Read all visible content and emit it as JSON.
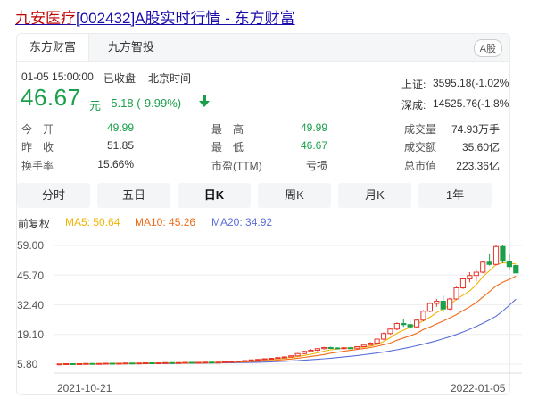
{
  "title": {
    "name_part": "九安医疗",
    "rest_part": "[002432]A股实时行情 - 东方财富"
  },
  "tabs": [
    "东方财富",
    "九方智投"
  ],
  "market_badge": "A股",
  "quote": {
    "datetime": "01-05 15:00:00",
    "status": "已收盘",
    "timezone": "北京时间",
    "price": "46.67",
    "unit": "元",
    "change": "-5.18 (-9.99%)"
  },
  "indices": [
    {
      "name": "上证:",
      "value": "3595.18(-1.02%)"
    },
    {
      "name": "深成:",
      "value": "14525.76(-1.8%)"
    }
  ],
  "stats": {
    "open_label": "今　开",
    "open": "49.99",
    "prev_label": "昨　收",
    "prev": "51.85",
    "turnover_label": "换手率",
    "turnover": "15.66%",
    "high_label": "最　高",
    "high": "49.99",
    "low_label": "最　低",
    "low": "46.67",
    "pe_label": "市盈(TTM)",
    "pe": "亏损",
    "vol_label": "成交量",
    "vol": "74.93万手",
    "amt_label": "成交额",
    "amt": "35.60亿",
    "cap_label": "总市值",
    "cap": "223.36亿"
  },
  "period_buttons": [
    "分时",
    "五日",
    "日K",
    "周K",
    "月K",
    "1年"
  ],
  "active_period": "日K",
  "indicators": {
    "adjust": "前复权",
    "ma5": "MA5: 50.64",
    "ma10": "MA10: 45.26",
    "ma20": "MA20: 34.92"
  },
  "colors": {
    "up": "#e8342d",
    "down": "#1aa04b",
    "ma5": "#f0b400",
    "ma10": "#f06a1a",
    "ma20": "#5b6ed8"
  },
  "chart_data": {
    "type": "candlestick",
    "y_ticks": [
      "59.00",
      "45.70",
      "32.40",
      "19.10",
      "5.80"
    ],
    "ylim": [
      5.8,
      59.0
    ],
    "x_labels": [
      "2021-10-21",
      "2022-01-05"
    ],
    "candles": [
      [
        5.8,
        5.9,
        5.7,
        5.9
      ],
      [
        5.9,
        6.0,
        5.8,
        6.0
      ],
      [
        6.0,
        6.0,
        5.9,
        5.9
      ],
      [
        5.9,
        6.0,
        5.8,
        6.0
      ],
      [
        6.0,
        6.1,
        5.9,
        6.1
      ],
      [
        6.1,
        6.1,
        6.0,
        6.0
      ],
      [
        6.0,
        6.1,
        5.9,
        6.1
      ],
      [
        6.1,
        6.2,
        6.0,
        6.2
      ],
      [
        6.2,
        6.2,
        6.1,
        6.1
      ],
      [
        6.1,
        6.2,
        6.0,
        6.2
      ],
      [
        6.2,
        6.3,
        6.1,
        6.3
      ],
      [
        6.3,
        6.3,
        6.2,
        6.2
      ],
      [
        6.2,
        6.3,
        6.1,
        6.3
      ],
      [
        6.3,
        6.4,
        6.2,
        6.4
      ],
      [
        6.4,
        6.4,
        6.3,
        6.3
      ],
      [
        6.3,
        6.4,
        6.2,
        6.4
      ],
      [
        6.4,
        6.5,
        6.3,
        6.5
      ],
      [
        6.5,
        6.5,
        6.4,
        6.4
      ],
      [
        6.4,
        6.5,
        6.3,
        6.5
      ],
      [
        6.5,
        6.6,
        6.4,
        6.6
      ],
      [
        6.6,
        6.6,
        6.5,
        6.5
      ],
      [
        6.5,
        6.6,
        6.4,
        6.6
      ],
      [
        6.6,
        6.7,
        6.5,
        6.7
      ],
      [
        6.7,
        6.7,
        6.6,
        6.6
      ],
      [
        6.6,
        6.7,
        6.5,
        6.7
      ],
      [
        6.7,
        6.9,
        6.6,
        6.9
      ],
      [
        6.9,
        7.1,
        6.8,
        7.0
      ],
      [
        7.0,
        7.3,
        6.9,
        7.2
      ],
      [
        7.2,
        7.5,
        7.1,
        7.4
      ],
      [
        7.4,
        7.8,
        7.3,
        7.7
      ],
      [
        7.7,
        8.1,
        7.6,
        7.9
      ],
      [
        7.9,
        8.3,
        7.8,
        8.2
      ],
      [
        8.2,
        8.6,
        8.1,
        8.4
      ],
      [
        8.4,
        8.9,
        8.3,
        8.7
      ],
      [
        8.7,
        9.3,
        8.6,
        9.0
      ],
      [
        9.0,
        9.8,
        8.9,
        9.5
      ],
      [
        9.5,
        10.8,
        9.4,
        10.5
      ],
      [
        10.5,
        11.8,
        10.2,
        11.5
      ],
      [
        11.5,
        12.5,
        11.0,
        12.0
      ],
      [
        12.0,
        13.0,
        11.6,
        12.7
      ],
      [
        12.7,
        13.5,
        12.3,
        13.2
      ],
      [
        13.2,
        13.6,
        12.8,
        13.0
      ],
      [
        13.0,
        13.4,
        12.6,
        12.9
      ],
      [
        12.9,
        13.3,
        12.5,
        13.1
      ],
      [
        13.1,
        13.5,
        12.7,
        12.9
      ],
      [
        12.9,
        13.8,
        12.7,
        13.6
      ],
      [
        13.6,
        14.5,
        13.4,
        14.3
      ],
      [
        14.3,
        15.6,
        14.2,
        15.2
      ],
      [
        15.2,
        17.5,
        15.0,
        17.0
      ],
      [
        17.0,
        20.0,
        16.5,
        19.5
      ],
      [
        19.5,
        22.0,
        19.0,
        21.5
      ],
      [
        21.5,
        24.5,
        21.0,
        24.0
      ],
      [
        24.0,
        26.0,
        22.5,
        23.5
      ],
      [
        23.5,
        25.5,
        21.5,
        22.5
      ],
      [
        22.5,
        26.0,
        22.0,
        25.5
      ],
      [
        25.5,
        30.0,
        25.0,
        29.5
      ],
      [
        29.5,
        33.5,
        29.0,
        33.0
      ],
      [
        33.0,
        35.0,
        31.5,
        34.0
      ],
      [
        34.0,
        36.5,
        29.0,
        30.5
      ],
      [
        30.5,
        35.5,
        30.0,
        35.0
      ],
      [
        35.0,
        40.5,
        34.5,
        40.0
      ],
      [
        40.0,
        44.5,
        39.5,
        44.0
      ],
      [
        44.0,
        47.0,
        42.5,
        45.5
      ],
      [
        45.5,
        48.0,
        43.0,
        47.0
      ],
      [
        47.0,
        52.0,
        46.5,
        51.5
      ],
      [
        51.5,
        55.0,
        50.0,
        50.5
      ],
      [
        50.5,
        59.0,
        50.0,
        58.5
      ],
      [
        58.5,
        59.0,
        51.0,
        51.9
      ],
      [
        51.9,
        55.0,
        48.0,
        49.5
      ],
      [
        49.99,
        49.99,
        46.67,
        46.67
      ]
    ],
    "ma5": [
      5.8,
      5.85,
      5.9,
      5.9,
      5.94,
      5.98,
      6.02,
      6.08,
      6.12,
      6.12,
      6.16,
      6.2,
      6.24,
      6.28,
      6.3,
      6.32,
      6.36,
      6.4,
      6.42,
      6.48,
      6.5,
      6.52,
      6.58,
      6.6,
      6.62,
      6.7,
      6.78,
      6.88,
      7.04,
      7.24,
      7.44,
      7.68,
      7.92,
      8.18,
      8.44,
      8.76,
      9.18,
      9.7,
      10.2,
      10.84,
      11.6,
      12.2,
      12.58,
      12.96,
      13.04,
      13.14,
      13.36,
      13.82,
      14.6,
      15.9,
      17.64,
      19.6,
      21.0,
      22.34,
      23.7,
      25.2,
      26.8,
      28.9,
      30.5,
      32.4,
      34.9,
      36.7,
      38.6,
      41.4,
      45.0,
      47.6,
      50.4,
      51.2,
      51.0,
      50.64
    ],
    "ma10": [
      5.8,
      5.82,
      5.85,
      5.87,
      5.9,
      5.92,
      5.95,
      5.98,
      6.01,
      6.03,
      6.07,
      6.1,
      6.14,
      6.18,
      6.21,
      6.24,
      6.28,
      6.31,
      6.34,
      6.38,
      6.41,
      6.44,
      6.48,
      6.51,
      6.55,
      6.6,
      6.66,
      6.73,
      6.82,
      6.93,
      7.07,
      7.22,
      7.4,
      7.61,
      7.84,
      8.1,
      8.43,
      8.8,
      9.22,
      9.64,
      10.1,
      10.69,
      11.13,
      11.58,
      11.94,
      12.37,
      12.78,
      13.2,
      13.8,
      14.47,
      15.2,
      16.48,
      17.5,
      18.47,
      19.6,
      21.3,
      22.4,
      23.8,
      25.1,
      26.5,
      28.0,
      29.8,
      31.5,
      33.4,
      35.9,
      38.3,
      40.8,
      42.5,
      43.8,
      45.26
    ],
    "ma20": [
      5.8,
      5.81,
      5.82,
      5.83,
      5.85,
      5.86,
      5.88,
      5.9,
      5.92,
      5.94,
      5.96,
      5.98,
      6.0,
      6.02,
      6.05,
      6.07,
      6.1,
      6.13,
      6.16,
      6.19,
      6.22,
      6.25,
      6.28,
      6.31,
      6.35,
      6.39,
      6.43,
      6.48,
      6.53,
      6.58,
      6.65,
      6.73,
      6.83,
      6.95,
      7.08,
      7.22,
      7.38,
      7.55,
      7.75,
      7.97,
      8.21,
      8.46,
      8.73,
      9.02,
      9.33,
      9.66,
      10.0,
      10.38,
      10.78,
      11.2,
      11.67,
      12.2,
      12.77,
      13.38,
      14.03,
      14.72,
      15.48,
      16.3,
      17.17,
      18.1,
      19.1,
      20.2,
      21.4,
      22.7,
      24.1,
      25.6,
      27.3,
      29.6,
      32.2,
      34.92
    ]
  }
}
